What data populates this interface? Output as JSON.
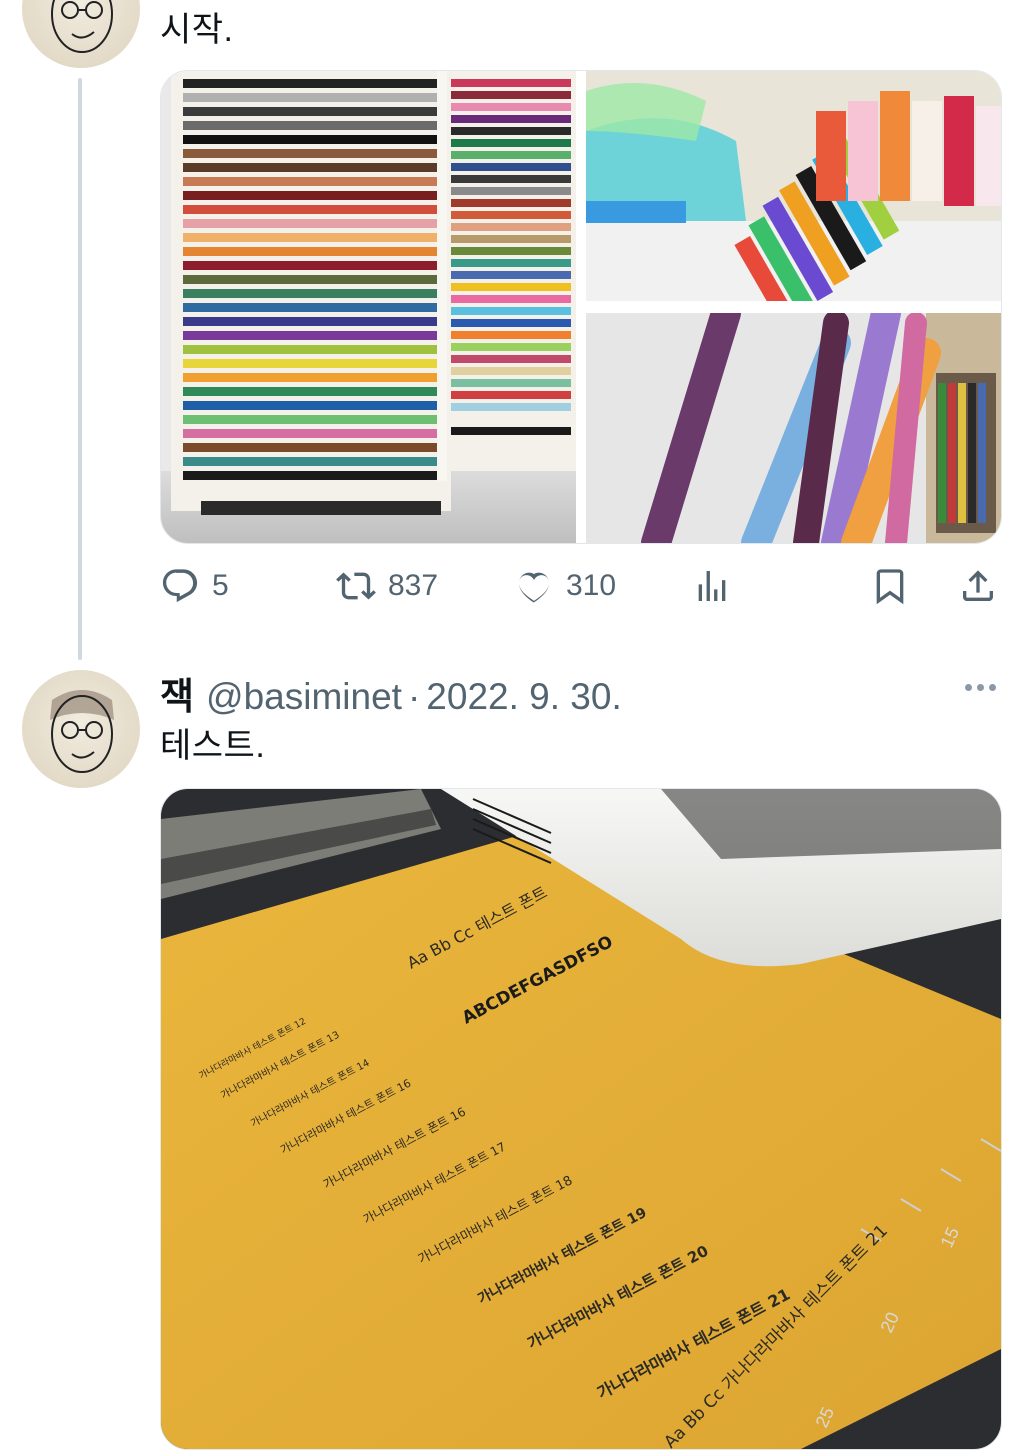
{
  "tweet1": {
    "text": "시작.",
    "actions": {
      "reply_count": "5",
      "retweet_count": "837",
      "like_count": "310"
    }
  },
  "tweet2": {
    "name": "잭",
    "handle": "@basiminet",
    "separator": "·",
    "date": "2022. 9. 30.",
    "text": "테스트.",
    "photo_text": {
      "line1": "Aa Bb Cc 테스트 폰트",
      "logo": "ABCDEFGASDFSO",
      "rows": [
        "가나다라마바사 테스트 폰트 12",
        "가나다라마바사 테스트 폰트 13",
        "가나다라마바사 테스트 폰트 14",
        "가나다라마바사 테스트 폰트 16",
        "가나다라마바사 테스트 폰트 16",
        "가나다라마바사 테스트 폰트 17",
        "가나다라마바사 테스트 폰트 18",
        "가나다라마바사 테스트 폰트 19",
        "가나다라마바사 테스트 폰트 20",
        "가나다라마바사 테스트 폰트 21"
      ],
      "bottom": "Aa Bb Cc 가나다라마바사 테스트 폰트 21",
      "ruler": [
        "15",
        "20",
        "25"
      ]
    }
  },
  "icons": {
    "reply": "comment-icon",
    "retweet": "retweet-icon",
    "like": "heart-icon",
    "views": "views-icon",
    "bookmark": "bookmark-icon",
    "share": "share-icon",
    "more": "more-icon"
  },
  "colors": {
    "text_primary": "#0f1419",
    "text_secondary": "#536471",
    "thread_line": "#cfd9de",
    "felt_yellow": "#e7b43a"
  }
}
